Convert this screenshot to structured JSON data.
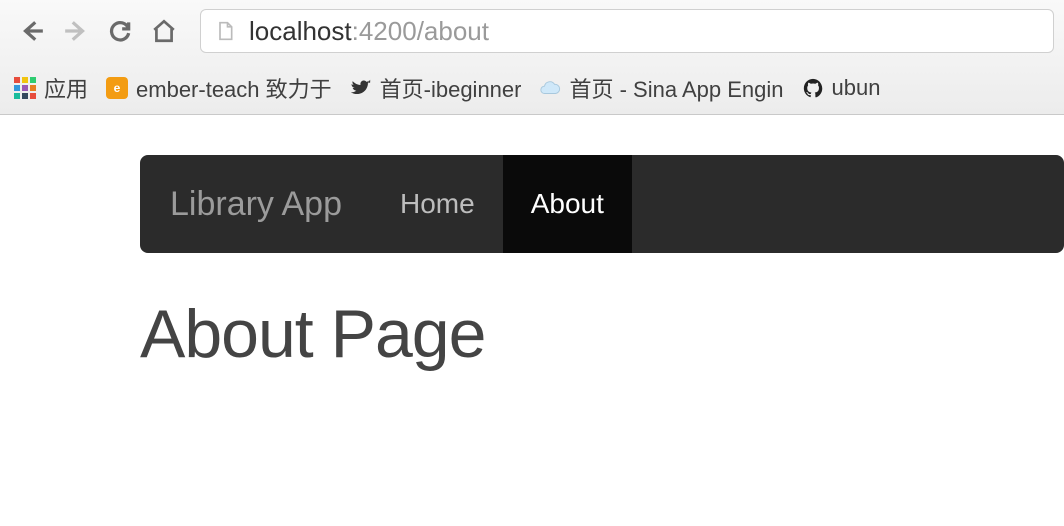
{
  "browser": {
    "url": {
      "host": "localhost",
      "port_path": ":4200/about"
    },
    "bookmarks": {
      "apps_label": "应用",
      "items": [
        {
          "label": "ember-teach 致力于"
        },
        {
          "label": "首页-ibeginner"
        },
        {
          "label": "首页 - Sina App Engin"
        },
        {
          "label": "ubun"
        }
      ]
    }
  },
  "app": {
    "brand": "Library App",
    "nav": [
      {
        "label": "Home",
        "active": false
      },
      {
        "label": "About",
        "active": true
      }
    ],
    "heading": "About Page"
  }
}
